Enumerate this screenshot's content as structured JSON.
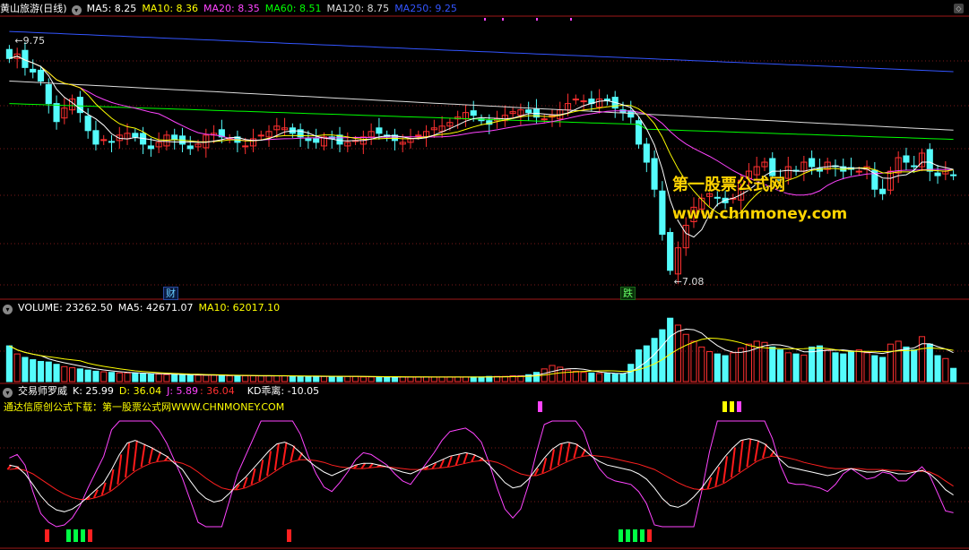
{
  "header": {
    "stock": "黄山旅游(日线)",
    "ma": [
      {
        "label": "MA5: 8.25",
        "color": "#ffffff"
      },
      {
        "label": "MA10: 8.36",
        "color": "#ffff00"
      },
      {
        "label": "MA20: 8.35",
        "color": "#ff44ff"
      },
      {
        "label": "MA60: 8.51",
        "color": "#00ff00"
      },
      {
        "label": "MA120: 8.75",
        "color": "#dddddd"
      },
      {
        "label": "MA250: 9.25",
        "color": "#3355ff"
      }
    ]
  },
  "volume_header": {
    "volume": "VOLUME: 23262.50",
    "ma5": "MA5: 42671.07",
    "ma10": "MA10: 62017.10"
  },
  "kdj_header": {
    "name": "交易师罗威",
    "k": "K: 25.99",
    "d": "D: 36.04",
    "j": "J: 5.89",
    "extra": ": 36.04",
    "kd": "KD乖离: -10.05"
  },
  "promo_text": "通达信原创公式下载：第一股票公式网WWW.CHNMONEY.COM",
  "annotations": {
    "high": "9.75",
    "low": "7.08",
    "tag_cai": "财",
    "tag_die": "跌"
  },
  "watermark": {
    "name": "第一股票公式网",
    "url": "www.chnmoney.com"
  },
  "colors": {
    "up": "#ff3030",
    "down": "#54fcfc",
    "ma5": "#ffffff",
    "ma10": "#ffff00",
    "ma20": "#ff44ff",
    "ma60": "#00ff00",
    "ma120": "#dddddd",
    "ma250": "#3355ff"
  },
  "chart_data": [
    {
      "type": "candlestick",
      "title": "黄山旅游(日线)",
      "ylim": [
        6.9,
        10.0
      ],
      "count": 121,
      "close": [
        9.55,
        9.6,
        9.45,
        9.4,
        9.3,
        9.05,
        8.85,
        9.0,
        9.1,
        8.95,
        8.75,
        8.6,
        8.65,
        8.62,
        8.7,
        8.72,
        8.68,
        8.6,
        8.55,
        8.62,
        8.7,
        8.65,
        8.6,
        8.55,
        8.6,
        8.7,
        8.72,
        8.68,
        8.66,
        8.62,
        8.58,
        8.66,
        8.7,
        8.74,
        8.8,
        8.78,
        8.72,
        8.68,
        8.64,
        8.62,
        8.68,
        8.66,
        8.6,
        8.62,
        8.64,
        8.68,
        8.74,
        8.72,
        8.68,
        8.64,
        8.62,
        8.66,
        8.7,
        8.74,
        8.78,
        8.8,
        8.84,
        8.9,
        8.95,
        8.92,
        8.86,
        8.82,
        8.88,
        8.92,
        8.96,
        8.98,
        8.95,
        8.9,
        8.88,
        8.92,
        8.98,
        9.05,
        9.1,
        9.08,
        9.05,
        9.1,
        9.08,
        9.0,
        8.95,
        8.9,
        8.6,
        8.4,
        8.1,
        7.6,
        7.2,
        7.45,
        7.7,
        7.9,
        8.0,
        8.05,
        8.0,
        7.95,
        8.0,
        8.2,
        8.3,
        8.35,
        8.4,
        8.25,
        8.2,
        8.35,
        8.3,
        8.4,
        8.35,
        8.3,
        8.4,
        8.35,
        8.3,
        8.32,
        8.3,
        8.35,
        8.1,
        8.05,
        8.3,
        8.45,
        8.4,
        8.35,
        8.5,
        8.3,
        8.25,
        8.3,
        8.25
      ]
    },
    {
      "type": "bar",
      "title": "VOLUME",
      "count": 121,
      "values": [
        62,
        48,
        42,
        38,
        35,
        34,
        30,
        26,
        24,
        22,
        20,
        18,
        17,
        16,
        15,
        15,
        14,
        14,
        13,
        13,
        12,
        12,
        12,
        11,
        11,
        11,
        11,
        11,
        10,
        10,
        10,
        10,
        10,
        10,
        10,
        10,
        9,
        9,
        9,
        9,
        9,
        9,
        9,
        9,
        9,
        8,
        8,
        8,
        8,
        8,
        8,
        8,
        8,
        8,
        8,
        8,
        8,
        8,
        8,
        8,
        8,
        9,
        9,
        9,
        10,
        10,
        12,
        16,
        22,
        28,
        25,
        20,
        18,
        16,
        15,
        14,
        14,
        13,
        14,
        30,
        55,
        62,
        75,
        90,
        110,
        98,
        82,
        70,
        60,
        52,
        48,
        45,
        50,
        58,
        65,
        70,
        68,
        60,
        55,
        50,
        48,
        46,
        60,
        62,
        55,
        50,
        48,
        52,
        55,
        50,
        45,
        42,
        65,
        70,
        60,
        55,
        78,
        65,
        45,
        40,
        23
      ]
    },
    {
      "type": "line",
      "title": "交易师罗威",
      "ylim": [
        -10,
        110
      ],
      "count": 121,
      "series": [
        {
          "name": "K",
          "values": [
            60,
            58,
            50,
            38,
            25,
            15,
            9,
            7,
            10,
            16,
            24,
            32,
            40,
            55,
            72,
            85,
            88,
            84,
            80,
            75,
            70,
            62,
            55,
            42,
            30,
            22,
            18,
            20,
            28,
            38,
            46,
            56,
            66,
            76,
            84,
            86,
            82,
            74,
            65,
            58,
            52,
            48,
            52,
            56,
            60,
            62,
            62,
            60,
            58,
            55,
            52,
            50,
            54,
            58,
            62,
            66,
            70,
            72,
            74,
            72,
            68,
            60,
            50,
            40,
            34,
            36,
            44,
            56,
            68,
            78,
            84,
            86,
            84,
            78,
            70,
            64,
            60,
            58,
            56,
            54,
            50,
            44,
            34,
            22,
            14,
            12,
            16,
            24,
            34,
            46,
            58,
            70,
            80,
            88,
            90,
            88,
            84,
            76,
            66,
            58,
            56,
            54,
            52,
            50,
            48,
            50,
            54,
            56,
            54,
            52,
            52,
            54,
            52,
            50,
            50,
            52,
            54,
            50,
            42,
            32,
            25.99
          ]
        },
        {
          "name": "D",
          "values": [
            55,
            56,
            54,
            50,
            44,
            38,
            32,
            27,
            23,
            21,
            21,
            23,
            26,
            31,
            38,
            46,
            53,
            58,
            62,
            64,
            65,
            64,
            62,
            58,
            52,
            45,
            39,
            34,
            32,
            32,
            34,
            38,
            42,
            48,
            54,
            60,
            64,
            66,
            66,
            65,
            63,
            60,
            58,
            57,
            56,
            56,
            57,
            58,
            58,
            57,
            56,
            55,
            55,
            55,
            56,
            57,
            58,
            60,
            62,
            64,
            65,
            65,
            63,
            59,
            54,
            50,
            48,
            48,
            51,
            55,
            60,
            64,
            68,
            70,
            71,
            70,
            69,
            67,
            65,
            63,
            61,
            58,
            55,
            50,
            45,
            40,
            36,
            33,
            32,
            33,
            36,
            40,
            46,
            52,
            58,
            64,
            68,
            70,
            70,
            68,
            66,
            63,
            61,
            59,
            57,
            56,
            56,
            56,
            56,
            55,
            55,
            55,
            54,
            54,
            53,
            53,
            53,
            52,
            48,
            42,
            36.04
          ]
        },
        {
          "name": "J",
          "values": [
            68,
            72,
            60,
            30,
            5,
            -5,
            -10,
            -8,
            0,
            14,
            34,
            52,
            70,
            100,
            140,
            160,
            155,
            140,
            120,
            100,
            85,
            65,
            45,
            20,
            -5,
            -15,
            -20,
            -10,
            20,
            50,
            70,
            90,
            110,
            130,
            150,
            140,
            120,
            95,
            70,
            50,
            35,
            30,
            40,
            52,
            66,
            74,
            72,
            66,
            60,
            50,
            42,
            38,
            50,
            62,
            74,
            88,
            98,
            100,
            102,
            96,
            86,
            62,
            34,
            10,
            0,
            10,
            38,
            74,
            106,
            128,
            136,
            132,
            120,
            98,
            72,
            56,
            46,
            42,
            40,
            38,
            30,
            16,
            -8,
            -30,
            -45,
            -50,
            -38,
            -10,
            30,
            75,
            110,
            135,
            150,
            158,
            152,
            138,
            118,
            90,
            60,
            40,
            38,
            38,
            36,
            34,
            30,
            38,
            50,
            56,
            50,
            44,
            46,
            52,
            50,
            42,
            42,
            50,
            58,
            48,
            28,
            8,
            5.89
          ]
        }
      ]
    }
  ]
}
